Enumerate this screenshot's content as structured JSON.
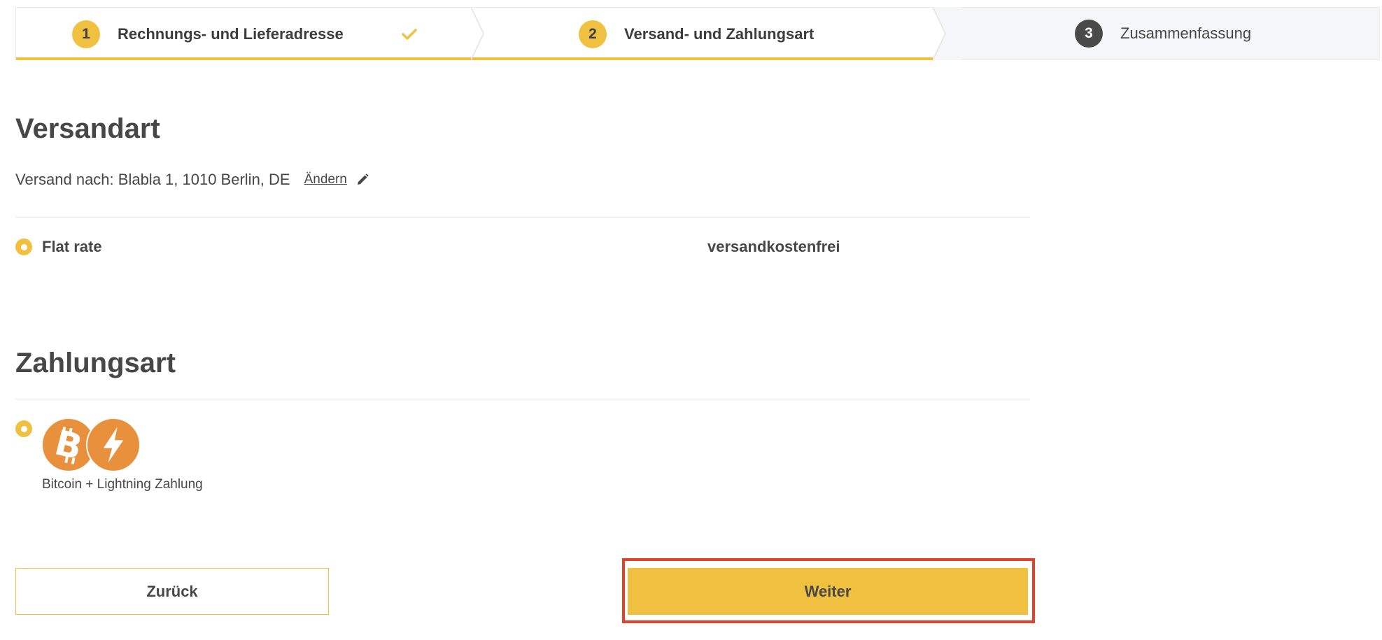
{
  "stepper": {
    "steps": [
      {
        "number": "1",
        "label": "Rechnungs- und Lieferadresse",
        "state": "completed"
      },
      {
        "number": "2",
        "label": "Versand- und Zahlungsart",
        "state": "active"
      },
      {
        "number": "3",
        "label": "Zusammenfassung",
        "state": "upcoming"
      }
    ]
  },
  "shipping": {
    "title": "Versandart",
    "ship_to": "Versand nach: Blabla 1, 1010 Berlin, DE",
    "change_label": "Ändern",
    "options": [
      {
        "label": "Flat rate",
        "price": "versandkostenfrei",
        "selected": true
      }
    ]
  },
  "payment": {
    "title": "Zahlungsart",
    "options": [
      {
        "label": "Bitcoin + Lightning Zahlung",
        "icons": [
          "bitcoin-icon",
          "lightning-icon"
        ],
        "selected": true
      }
    ]
  },
  "actions": {
    "back_label": "Zurück",
    "next_label": "Weiter"
  },
  "colors": {
    "accent": "#f0c041",
    "text": "#474747",
    "bitcoin_orange": "#e8903b",
    "highlight": "#e0432b"
  }
}
